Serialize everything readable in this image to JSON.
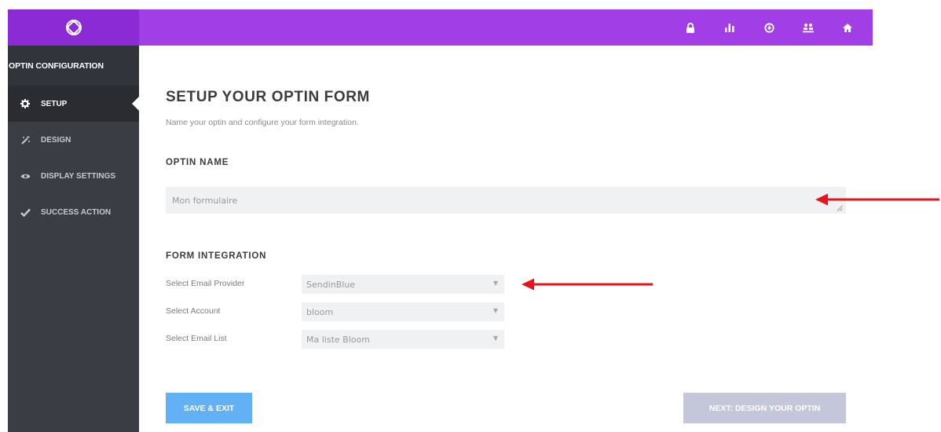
{
  "topbar": {
    "logo": "bloom-logo-icon",
    "icons": [
      "lock-icon",
      "stats-icon",
      "import-export-icon",
      "accounts-icon",
      "home-icon"
    ]
  },
  "sidebar": {
    "header": "OPTIN CONFIGURATION",
    "items": [
      {
        "label": "SETUP",
        "icon": "gear-icon",
        "active": true
      },
      {
        "label": "DESIGN",
        "icon": "magic-wand-icon",
        "active": false
      },
      {
        "label": "DISPLAY SETTINGS",
        "icon": "eye-icon",
        "active": false
      },
      {
        "label": "SUCCESS ACTION",
        "icon": "checkmark-icon",
        "active": false
      }
    ]
  },
  "main": {
    "title": "SETUP YOUR OPTIN FORM",
    "subtitle": "Name your optin and configure your form integration.",
    "optin_name": {
      "heading": "OPTIN NAME",
      "value": "Mon formulaire"
    },
    "integration": {
      "heading": "FORM INTEGRATION",
      "rows": [
        {
          "label": "Select Email Provider",
          "value": "SendinBlue"
        },
        {
          "label": "Select Account",
          "value": "bloom"
        },
        {
          "label": "Select Email List",
          "value": "Ma liste Bloom"
        }
      ]
    },
    "save_label": "SAVE & EXIT",
    "next_label": "NEXT: DESIGN YOUR OPTIN"
  },
  "colors": {
    "topbar": "#a23ee6",
    "logo_cell": "#8a2bd5",
    "sidebar": "#3a3d44",
    "save_button": "#62b1f6",
    "next_button": "#c4c6d9",
    "annotation_arrow": "#e8141c"
  }
}
